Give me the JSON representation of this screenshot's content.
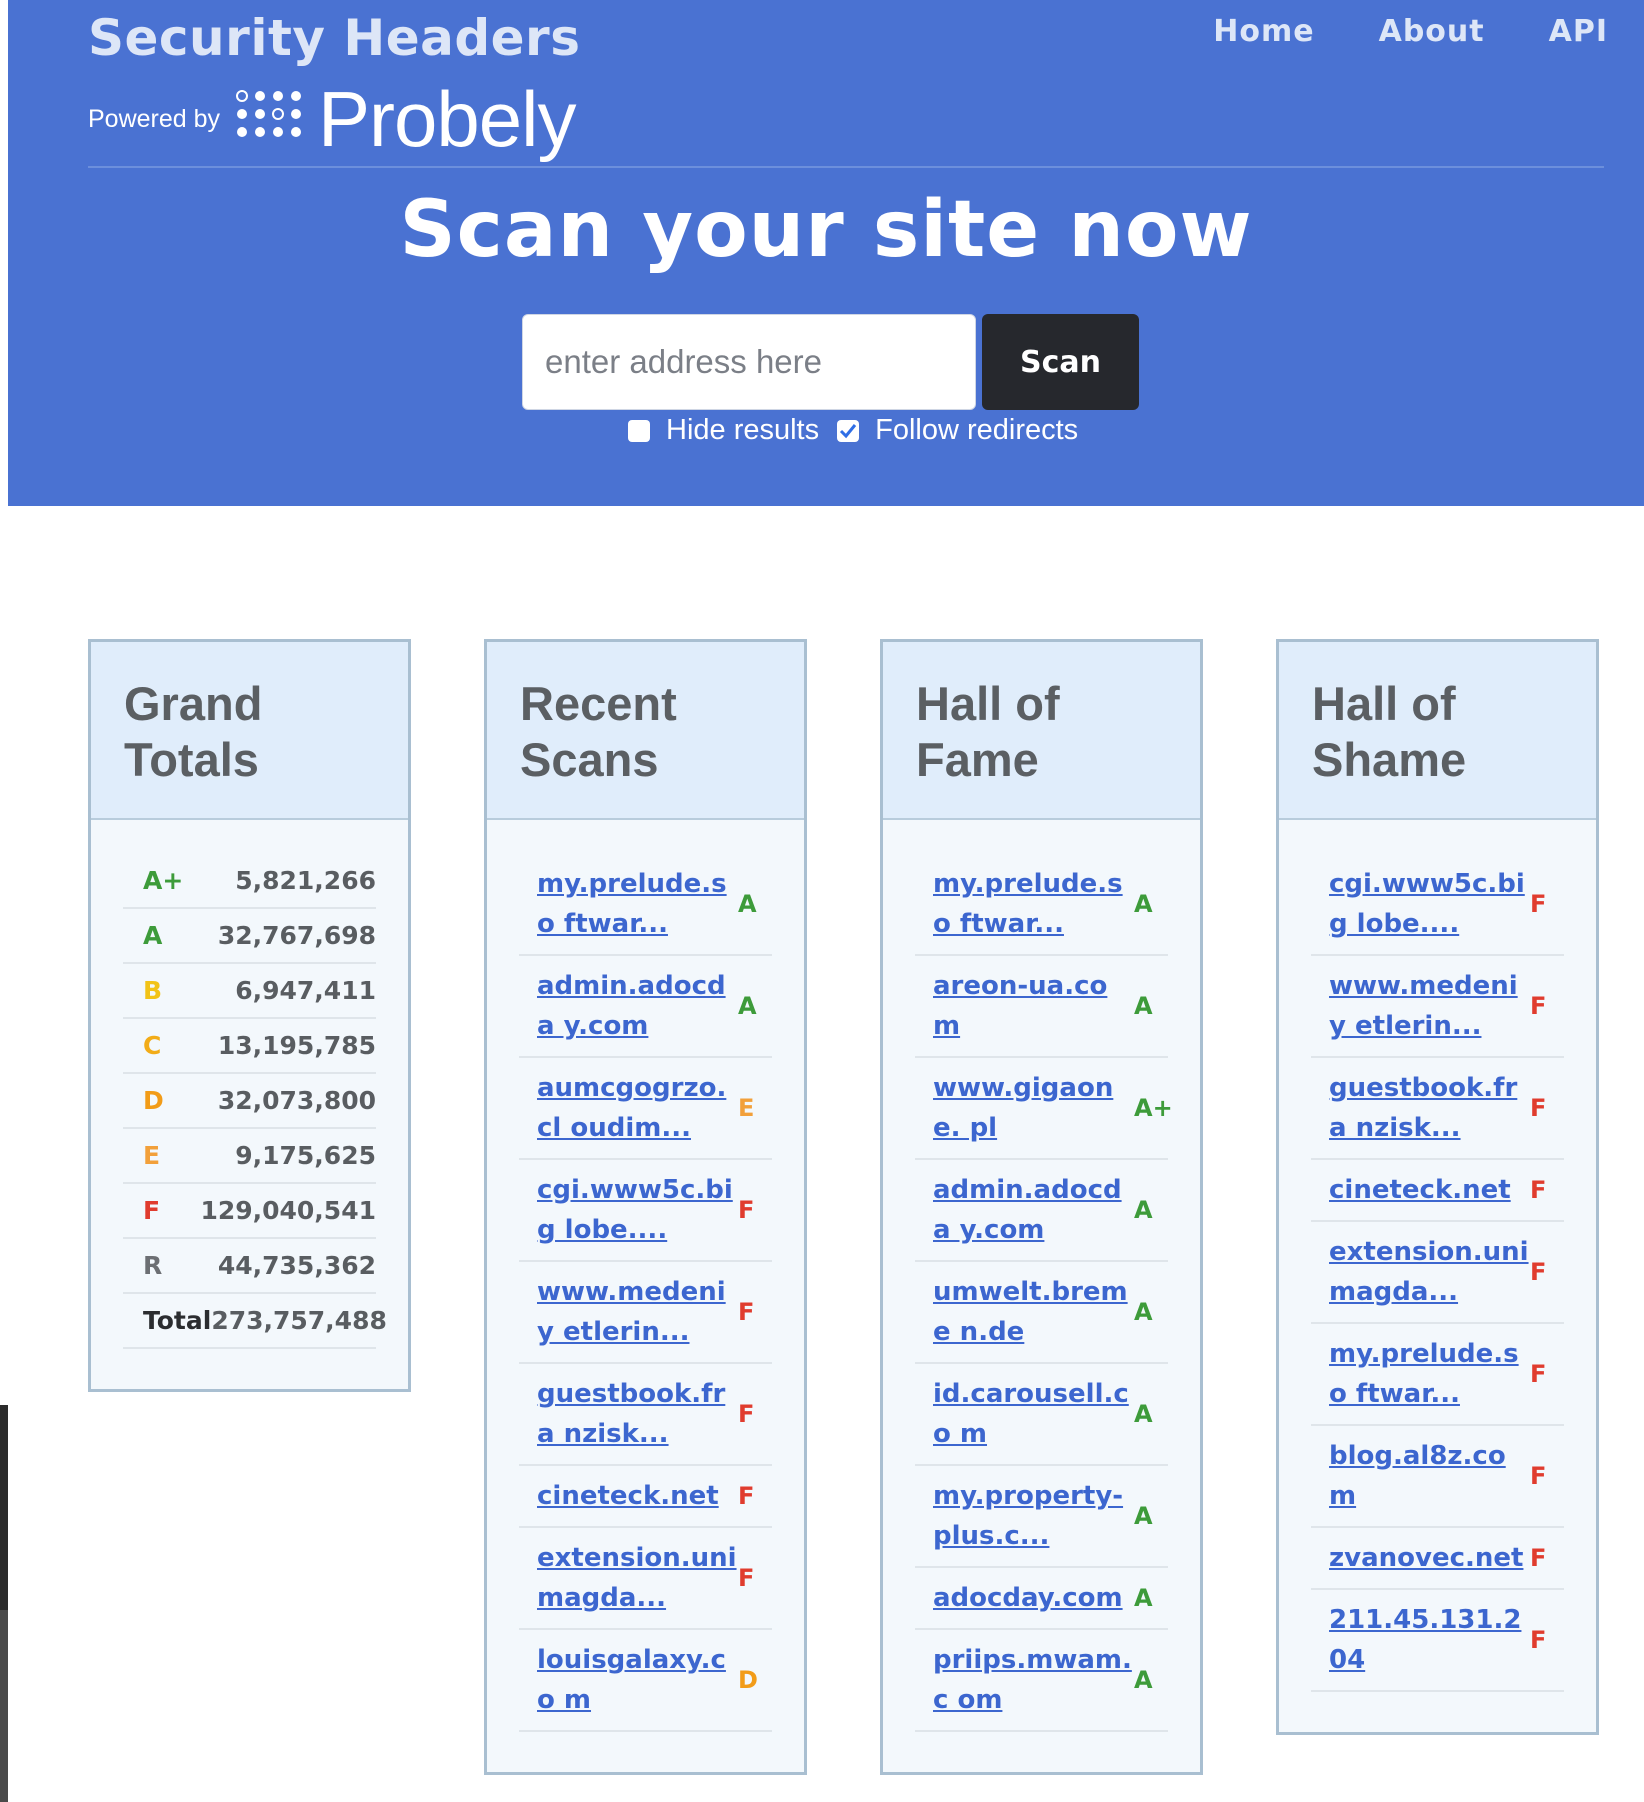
{
  "header": {
    "title": "Security Headers",
    "powered_by": "Powered by",
    "brand": "Probely",
    "nav": [
      "Home",
      "About",
      "API"
    ],
    "hero": "Scan your site now",
    "input_placeholder": "enter address here",
    "scan_label": "Scan",
    "hide_results_label": "Hide results",
    "hide_results_checked": false,
    "follow_redirects_label": "Follow redirects",
    "follow_redirects_checked": true,
    "bg_color": "#4a72d2"
  },
  "grade_colors": {
    "A+": "#3d9b3a",
    "A": "#3d9b3a",
    "B": "#f2c318",
    "C": "#f2ac18",
    "D": "#f29c18",
    "E": "#f2a03a",
    "F": "#e03c2e",
    "R": "#6c6f73",
    "Total": "#2b2d30"
  },
  "panels": {
    "grand_totals": {
      "title": "Grand Totals",
      "rows": [
        {
          "grade": "A+",
          "count": "5,821,266"
        },
        {
          "grade": "A",
          "count": "32,767,698"
        },
        {
          "grade": "B",
          "count": "6,947,411"
        },
        {
          "grade": "C",
          "count": "13,195,785"
        },
        {
          "grade": "D",
          "count": "32,073,800"
        },
        {
          "grade": "E",
          "count": "9,175,625"
        },
        {
          "grade": "F",
          "count": "129,040,541"
        },
        {
          "grade": "R",
          "count": "44,735,362"
        },
        {
          "grade": "Total",
          "count": "273,757,488"
        }
      ]
    },
    "recent_scans": {
      "title": "Recent Scans",
      "rows": [
        {
          "site": "my.prelude.software...",
          "display": "my.prelude.so ftwar...",
          "grade": "A"
        },
        {
          "site": "admin.adocday.com",
          "display": "admin.adocda y.com",
          "grade": "A"
        },
        {
          "site": "aumcgogrzo.cloudim...",
          "display": "aumcgogrzo.cl oudim...",
          "grade": "E"
        },
        {
          "site": "cgi.www5c.biglobe....",
          "display": "cgi.www5c.big lobe....",
          "grade": "F"
        },
        {
          "site": "www.medeniyetlerin...",
          "display": "www.medeniy etlerin...",
          "grade": "F"
        },
        {
          "site": "guestbook.franzisk...",
          "display": "guestbook.fra nzisk...",
          "grade": "F"
        },
        {
          "site": "cineteck.net",
          "display": "cineteck.net",
          "grade": "F"
        },
        {
          "site": "extension.unimagda...",
          "display": "extension.uni magda...",
          "grade": "F"
        },
        {
          "site": "louisgalaxy.com",
          "display": "louisgalaxy.co m",
          "grade": "D"
        }
      ]
    },
    "hall_of_fame": {
      "title": "Hall of Fame",
      "rows": [
        {
          "site": "my.prelude.software...",
          "display": "my.prelude.so ftwar...",
          "grade": "A"
        },
        {
          "site": "areon-ua.com",
          "display": "areon-ua.com",
          "grade": "A"
        },
        {
          "site": "www.gigaone.pl",
          "display": "www.gigaone. pl",
          "grade": "A+"
        },
        {
          "site": "admin.adocday.com",
          "display": "admin.adocda y.com",
          "grade": "A"
        },
        {
          "site": "umwelt.bremen.de",
          "display": "umwelt.breme n.de",
          "grade": "A"
        },
        {
          "site": "id.carousell.com",
          "display": "id.carousell.co m",
          "grade": "A"
        },
        {
          "site": "my.property-plus.c...",
          "display": "my.property- plus.c...",
          "grade": "A"
        },
        {
          "site": "adocday.com",
          "display": "adocday.com",
          "grade": "A"
        },
        {
          "site": "priips.mwam.com",
          "display": "priips.mwam.c om",
          "grade": "A"
        }
      ]
    },
    "hall_of_shame": {
      "title": "Hall of Shame",
      "rows": [
        {
          "site": "cgi.www5c.biglobe....",
          "display": "cgi.www5c.big lobe....",
          "grade": "F"
        },
        {
          "site": "www.medeniyetlerin...",
          "display": "www.medeniy etlerin...",
          "grade": "F"
        },
        {
          "site": "guestbook.franzisk...",
          "display": "guestbook.fra nzisk...",
          "grade": "F"
        },
        {
          "site": "cineteck.net",
          "display": "cineteck.net",
          "grade": "F"
        },
        {
          "site": "extension.unimagda...",
          "display": "extension.uni magda...",
          "grade": "F"
        },
        {
          "site": "my.prelude.software...",
          "display": "my.prelude.so ftwar...",
          "grade": "F"
        },
        {
          "site": "blog.al8z.com",
          "display": "blog.al8z.com",
          "grade": "F"
        },
        {
          "site": "zvanovec.net",
          "display": "zvanovec.net",
          "grade": "F"
        },
        {
          "site": "211.45.131.204",
          "display": "211.45.131.204",
          "grade": "F"
        }
      ]
    }
  }
}
